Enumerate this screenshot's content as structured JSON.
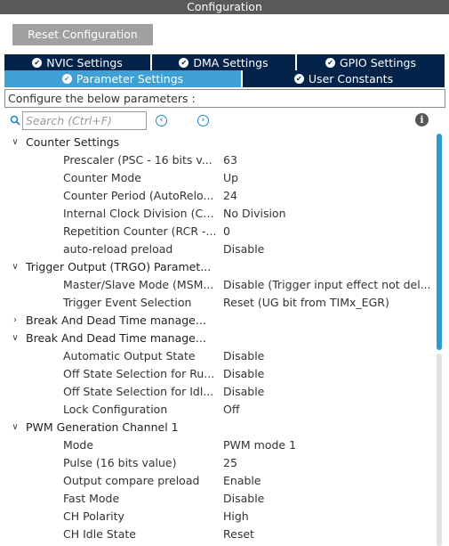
{
  "window": {
    "title": "Configuration"
  },
  "reset_button": {
    "label": "Reset Configuration"
  },
  "tabs_row1": [
    {
      "label": "NVIC Settings"
    },
    {
      "label": "DMA Settings"
    },
    {
      "label": "GPIO Settings"
    }
  ],
  "tabs_row2": [
    {
      "label": "Parameter Settings",
      "active": true
    },
    {
      "label": "User Constants",
      "active": false
    }
  ],
  "configure_text": "Configure the below parameters :",
  "search": {
    "placeholder": "Search (Ctrl+F)"
  },
  "colors": {
    "tab_dark": "#03234b",
    "tab_active": "#3ea0d5",
    "accent": "#2a9ad8",
    "titlebar": "#5a5a5a"
  },
  "tree": {
    "counter_settings": {
      "label": "Counter Settings",
      "expanded": true,
      "params": [
        {
          "name": "Prescaler (PSC - 16 bits v...",
          "value": "63"
        },
        {
          "name": "Counter Mode",
          "value": "Up"
        },
        {
          "name": "Counter Period (AutoRelo...",
          "value": "24"
        },
        {
          "name": "Internal Clock Division (CK...",
          "value": "No Division"
        },
        {
          "name": "Repetition Counter (RCR -...",
          "value": "0"
        },
        {
          "name": "auto-reload preload",
          "value": "Disable"
        }
      ]
    },
    "trigger_output": {
      "label": "Trigger Output (TRGO) Paramet...",
      "expanded": true,
      "params": [
        {
          "name": "Master/Slave Mode (MSM...",
          "value": "Disable (Trigger input effect not del..."
        },
        {
          "name": "Trigger Event Selection",
          "value": "Reset (UG bit from TIMx_EGR)"
        }
      ]
    },
    "break_dead_time_1": {
      "label": "Break And Dead Time manage...",
      "expanded": false
    },
    "break_dead_time_2": {
      "label": "Break And Dead Time manage...",
      "expanded": true,
      "params": [
        {
          "name": "Automatic Output State",
          "value": "Disable"
        },
        {
          "name": "Off State Selection for Ru...",
          "value": "Disable"
        },
        {
          "name": "Off State Selection for Idl...",
          "value": "Disable"
        },
        {
          "name": "Lock Configuration",
          "value": "Off"
        }
      ]
    },
    "pwm_channel_1": {
      "label": "PWM Generation Channel 1",
      "expanded": true,
      "params": [
        {
          "name": "Mode",
          "value": "PWM mode 1"
        },
        {
          "name": "Pulse (16 bits value)",
          "value": "25"
        },
        {
          "name": "Output compare preload",
          "value": "Enable"
        },
        {
          "name": "Fast Mode",
          "value": "Disable"
        },
        {
          "name": "CH Polarity",
          "value": "High"
        },
        {
          "name": "CH Idle State",
          "value": "Reset"
        }
      ]
    }
  }
}
